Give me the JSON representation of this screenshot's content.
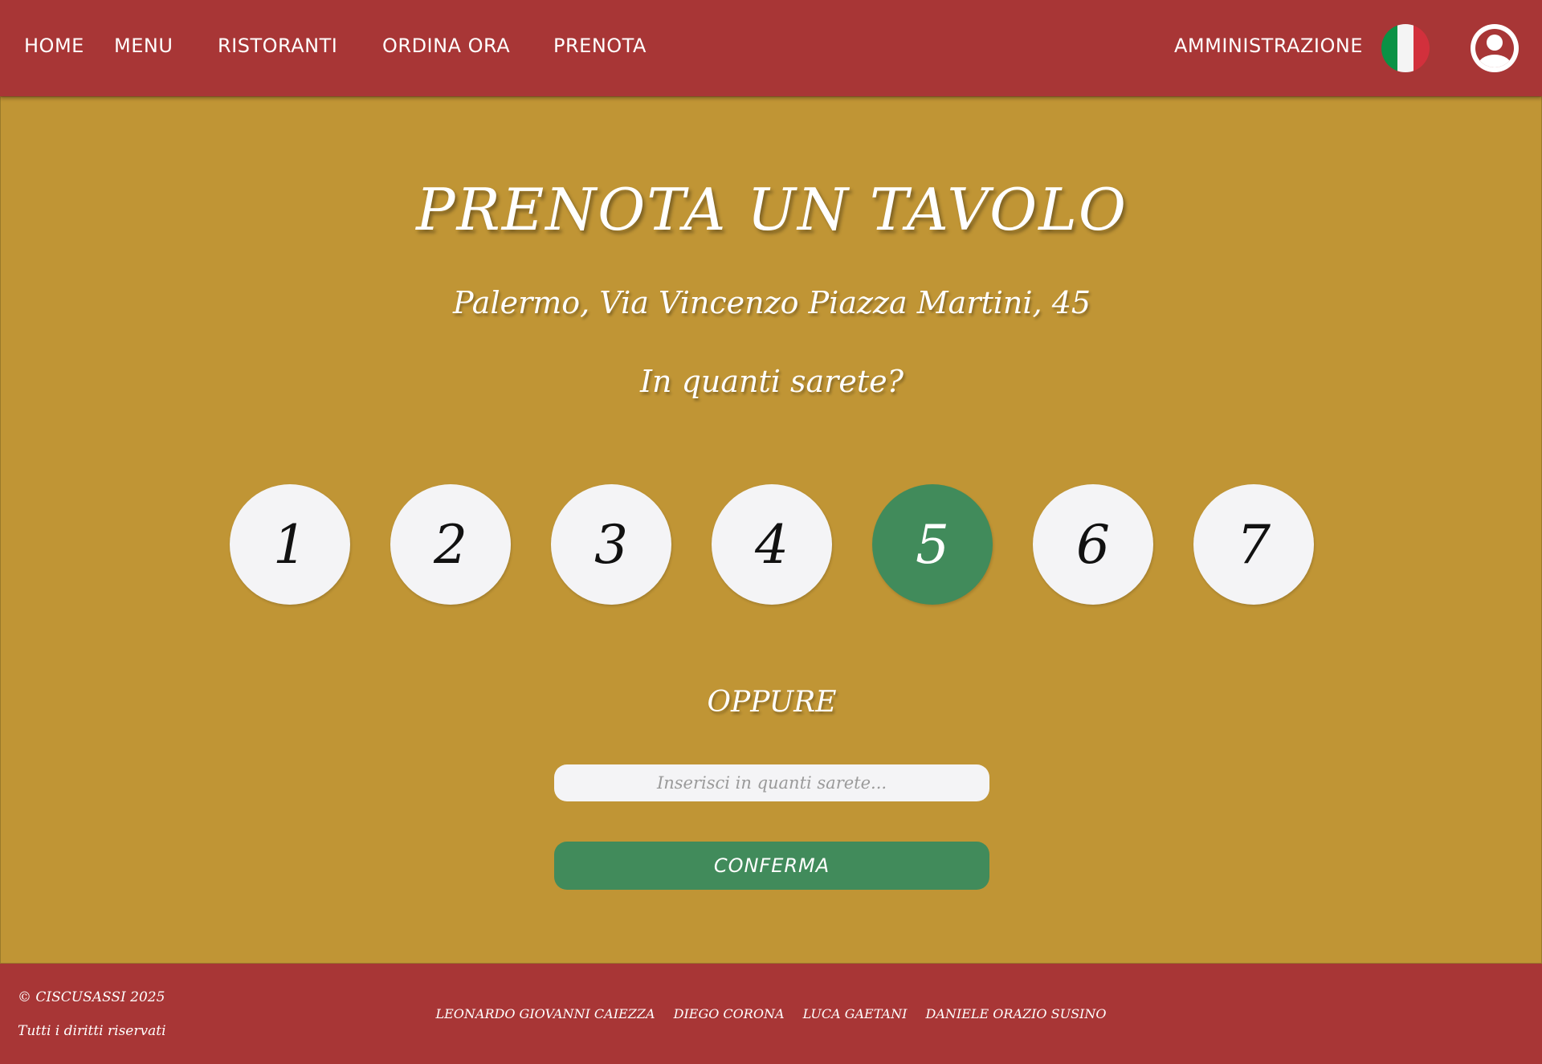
{
  "header": {
    "nav": {
      "home": "HOME",
      "menu": "MENU",
      "restaurants": "RISTORANTI",
      "order_now": "ORDINA ORA",
      "book": "PRENOTA"
    },
    "admin": "AMMINISTRAZIONE",
    "language_icon": "italian-flag-icon",
    "user_icon": "user-circle-icon",
    "colors": {
      "background": "#a83636",
      "flag_green": "#0a9245",
      "flag_white": "#f4f4f4",
      "flag_red": "#d2303c"
    }
  },
  "main": {
    "title": "PRENOTA UN TAVOLO",
    "address": "Palermo, Via Vincenzo Piazza Martini, 45",
    "question": "In quanti sarete?",
    "party_sizes": [
      "1",
      "2",
      "3",
      "4",
      "5",
      "6",
      "7"
    ],
    "selected_size": "5",
    "or_label": "OPPURE",
    "input_placeholder": "Inserisci in quanti sarete...",
    "confirm_label": "CONFERMA",
    "colors": {
      "background": "#c09535",
      "accent": "#418b5b",
      "circle": "#f4f4f6"
    }
  },
  "footer": {
    "copyright": "© CISCUSASSI 2025",
    "rights": "Tutti i diritti riservati",
    "authors": [
      "LEONARDO GIOVANNI CAIEZZA",
      "DIEGO CORONA",
      "LUCA GAETANI",
      "DANIELE ORAZIO SUSINO"
    ]
  }
}
